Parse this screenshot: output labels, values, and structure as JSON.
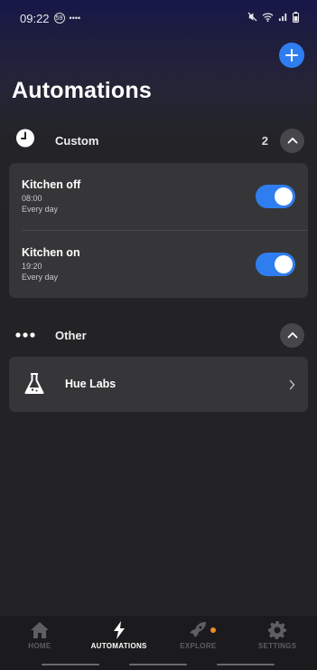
{
  "status_bar": {
    "time": "09:22",
    "badge": "59",
    "dots": "••••"
  },
  "header": {
    "title": "Automations",
    "add_icon": "plus-icon"
  },
  "custom_section": {
    "label": "Custom",
    "count": "2",
    "icon": "clock-icon",
    "items": [
      {
        "name": "Kitchen off",
        "time": "08:00",
        "days": "Every day",
        "enabled": true
      },
      {
        "name": "Kitchen on",
        "time": "19:20",
        "days": "Every day",
        "enabled": true
      }
    ]
  },
  "other_section": {
    "label": "Other",
    "icon": "more-dots-icon",
    "items": [
      {
        "name": "Hue Labs",
        "icon": "flask-icon"
      }
    ]
  },
  "bottom_nav": {
    "items": [
      {
        "label": "HOME",
        "icon": "home-icon",
        "active": false
      },
      {
        "label": "AUTOMATIONS",
        "icon": "lightning-icon",
        "active": true
      },
      {
        "label": "EXPLORE",
        "icon": "rocket-icon",
        "active": false,
        "dot": true
      },
      {
        "label": "SETTINGS",
        "icon": "gear-icon",
        "active": false
      }
    ]
  },
  "colors": {
    "accent": "#2f7ef0",
    "background": "#232325",
    "card": "#363638",
    "notification_dot": "#f0892a"
  }
}
